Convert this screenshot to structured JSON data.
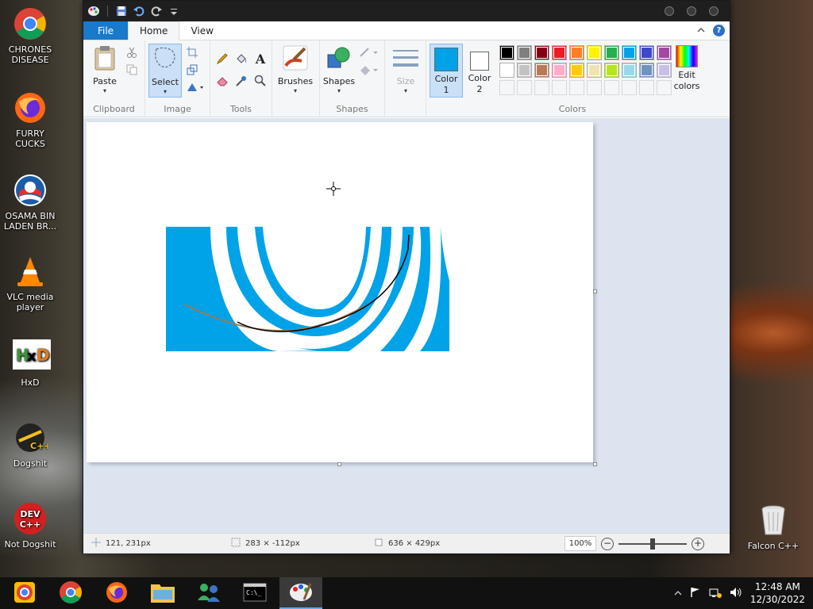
{
  "desktop": {
    "icons": [
      {
        "label": "CHRONES DISEASE"
      },
      {
        "label": "FURRY CUCKS"
      },
      {
        "label": "OSAMA BIN LADEN BR..."
      },
      {
        "label": "VLC media player"
      },
      {
        "label": "HxD"
      },
      {
        "label": "Dogshit"
      },
      {
        "label": "Not Dogshit"
      }
    ],
    "recycle_bin_label": "Falcon C++"
  },
  "paint": {
    "tabs": {
      "file": "File",
      "home": "Home",
      "view": "View"
    },
    "ribbon": {
      "clipboard": {
        "group_label": "Clipboard",
        "paste_label": "Paste"
      },
      "image": {
        "group_label": "Image",
        "select_label": "Select"
      },
      "tools": {
        "group_label": "Tools"
      },
      "brushes_label": "Brushes",
      "shapes": {
        "group_label": "Shapes",
        "shapes_label": "Shapes"
      },
      "size_label": "Size",
      "colors": {
        "group_label": "Colors",
        "color1_label": "Color",
        "color1_num": "1",
        "color2_label": "Color",
        "color2_num": "2",
        "edit_colors_label": "Edit colors",
        "color1_value": "#00a2e8",
        "color2_value": "#ffffff",
        "palette_row1": [
          "#000000",
          "#7f7f7f",
          "#880015",
          "#ed1c24",
          "#ff7f27",
          "#fff200",
          "#22b14c",
          "#00a2e8",
          "#3f48cc",
          "#a349a4"
        ],
        "palette_row2": [
          "#ffffff",
          "#c3c3c3",
          "#b97a57",
          "#ffaec9",
          "#ffc90e",
          "#efe4b0",
          "#b5e61d",
          "#99d9ea",
          "#7092be",
          "#c8bfe7"
        ]
      }
    },
    "statusbar": {
      "cursor_pos": "121, 231px",
      "selection_size": "283 × -112px",
      "image_size": "636 × 429px",
      "zoom": "100%",
      "zoom_level": 0.5
    }
  },
  "taskbar": {
    "time": "12:48 AM",
    "date": "12/30/2022"
  }
}
